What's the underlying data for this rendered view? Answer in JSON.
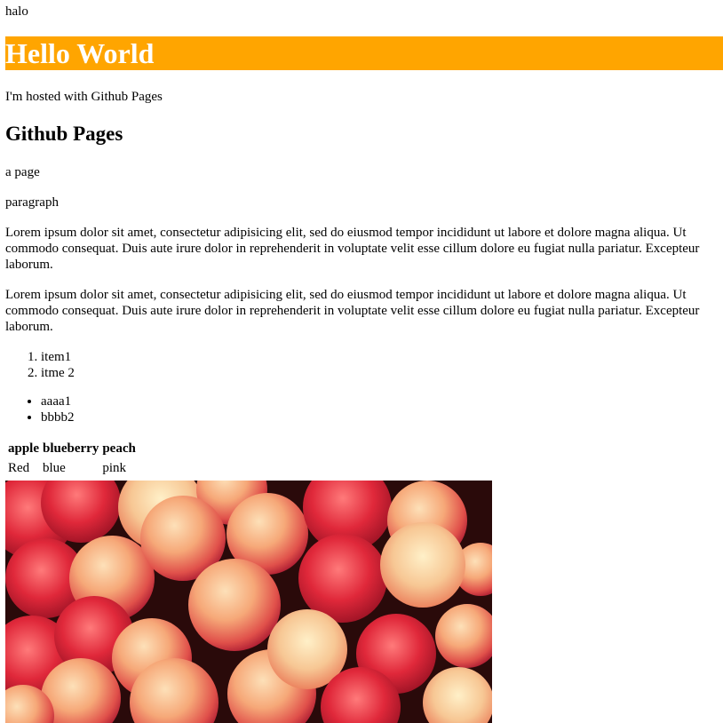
{
  "header": {
    "halo": "halo",
    "hero_title": "Hello World",
    "hosted_text": "I'm hosted with Github Pages"
  },
  "section": {
    "heading": "Github Pages",
    "subtitle": "a page",
    "paragraph_label": "paragraph"
  },
  "lorem": [
    {
      "lines": [
        "Lorem ipsum dolor sit amet, consectetur adipisicing elit, sed do eiusmod tempor incididunt ut labore et dolore magna aliqua. Ut",
        "commodo consequat. Duis aute irure dolor in reprehenderit in voluptate velit esse cillum dolore eu fugiat nulla pariatur. Excepteur",
        "laborum."
      ]
    },
    {
      "lines": [
        "Lorem ipsum dolor sit amet, consectetur adipisicing elit, sed do eiusmod tempor incididunt ut labore et dolore magna aliqua. Ut",
        "commodo consequat. Duis aute irure dolor in reprehenderit in voluptate velit esse cillum dolore eu fugiat nulla pariatur. Excepteur",
        "laborum."
      ]
    }
  ],
  "ordered_list": [
    "item1",
    "itme 2"
  ],
  "unordered_list": [
    "aaaa1",
    "bbbb2"
  ],
  "table": {
    "headers": [
      "apple",
      "blueberry",
      "peach"
    ],
    "rows": [
      [
        "Red",
        "blue",
        "pink"
      ]
    ]
  },
  "image": {
    "icon": "peaches-photo",
    "colors": {
      "background": "#2a0a0a",
      "peach_light": "#f6b98f",
      "peach_red": "#d8283a",
      "peach_deep": "#b3122a"
    }
  },
  "colors": {
    "hero_bg": "#ffa500",
    "hero_text": "#ffffff"
  }
}
